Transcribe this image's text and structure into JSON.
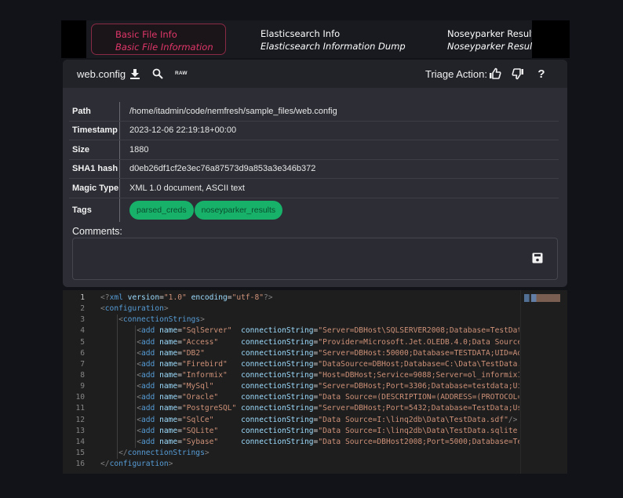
{
  "nav": {
    "tabs": [
      {
        "title": "Basic File Info",
        "subtitle": "Basic File Information",
        "active": true
      },
      {
        "title": "Elasticsearch Info",
        "subtitle": "Elasticsearch Information Dump",
        "active": false
      },
      {
        "title": "Noseyparker Results",
        "subtitle": "Noseyparker Results",
        "active": false
      }
    ]
  },
  "header": {
    "filename": "web.config",
    "download_icon": "download-icon",
    "search_icon": "search-icon",
    "raw_label": "RAW",
    "triage_label": "Triage Action:",
    "thumbs_up_icon": "thumbs-up-icon",
    "thumbs_down_icon": "thumbs-down-icon",
    "help_label": "?"
  },
  "metadata": [
    {
      "key": "Path",
      "value": "/home/itadmin/code/nemfresh/sample_files/web.config"
    },
    {
      "key": "Timestamp",
      "value": "2023-12-06 22:19:18+00:00"
    },
    {
      "key": "Size",
      "value": "1880"
    },
    {
      "key": "SHA1 hash",
      "value": "d0eb26df1cf2e3ec76a87573d9a853a3e346b372"
    },
    {
      "key": "Magic Type",
      "value": "XML 1.0 document, ASCII text"
    }
  ],
  "tags": {
    "label": "Tags",
    "items": [
      "parsed_creds",
      "noseyparker_results"
    ],
    "color": "#18b16a"
  },
  "comments": {
    "label": "Comments:",
    "value": "",
    "save_icon": "save-icon"
  },
  "editor": {
    "lines": [
      {
        "n": "1",
        "indent": 0,
        "kind": "decl",
        "text": "<?xml version=\"1.0\" encoding=\"utf-8\"?>"
      },
      {
        "n": "2",
        "indent": 0,
        "kind": "open",
        "tag": "configuration"
      },
      {
        "n": "3",
        "indent": 1,
        "kind": "open",
        "tag": "connectionStrings"
      },
      {
        "n": "4",
        "indent": 2,
        "kind": "add",
        "name": "SqlServer",
        "pad": "  ",
        "cs": "Server=DBHost\\SQLSERVER2008;Database=TestDat"
      },
      {
        "n": "5",
        "indent": 2,
        "kind": "add",
        "name": "Access",
        "pad": "     ",
        "cs": "Provider=Microsoft.Jet.OLEDB.4.0;Data Source"
      },
      {
        "n": "6",
        "indent": 2,
        "kind": "add",
        "name": "DB2",
        "pad": "        ",
        "cs": "Server=DBHost:50000;Database=TESTDATA;UID=Ad"
      },
      {
        "n": "7",
        "indent": 2,
        "kind": "add",
        "name": "Firebird",
        "pad": "   ",
        "cs": "DataSource=DBHost;Database=C:\\Data\\TestData."
      },
      {
        "n": "8",
        "indent": 2,
        "kind": "add",
        "name": "Informix",
        "pad": "   ",
        "cs": "Host=DBHost;Service=9088;Server=ol_informix1"
      },
      {
        "n": "9",
        "indent": 2,
        "kind": "add",
        "name": "MySql",
        "pad": "      ",
        "cs": "Server=DBHost;Port=3306;Database=testdata;Ui"
      },
      {
        "n": "10",
        "indent": 2,
        "kind": "add",
        "name": "Oracle",
        "pad": "     ",
        "cs": "Data Source=(DESCRIPTION=(ADDRESS=(PROTOCOL="
      },
      {
        "n": "11",
        "indent": 2,
        "kind": "add",
        "name": "PostgreSQL",
        "pad": " ",
        "cs": "Server=DBHost;Port=5432;Database=TestData;Us"
      },
      {
        "n": "12",
        "indent": 2,
        "kind": "add",
        "name": "SqlCe",
        "pad": "      ",
        "cs": "Data Source=I:\\linq2db\\Data\\TestData.sdf",
        "close": "/>"
      },
      {
        "n": "13",
        "indent": 2,
        "kind": "add",
        "name": "SQLite",
        "pad": "     ",
        "cs": "Data Source=I:\\linq2db\\Data\\TestData.sqlite"
      },
      {
        "n": "14",
        "indent": 2,
        "kind": "add",
        "name": "Sybase",
        "pad": "     ",
        "cs": "Data Source=DBHost2008;Port=5000;Database=Te"
      },
      {
        "n": "15",
        "indent": 1,
        "kind": "close",
        "tag": "connectionStrings"
      },
      {
        "n": "16",
        "indent": 0,
        "kind": "close",
        "tag": "configuration"
      }
    ],
    "current_line": "1",
    "colors": {
      "tag": "#569cd6",
      "attr": "#9cdcfe",
      "string": "#ce9178",
      "punct": "#808080"
    }
  },
  "accent_color": "#e0376a"
}
